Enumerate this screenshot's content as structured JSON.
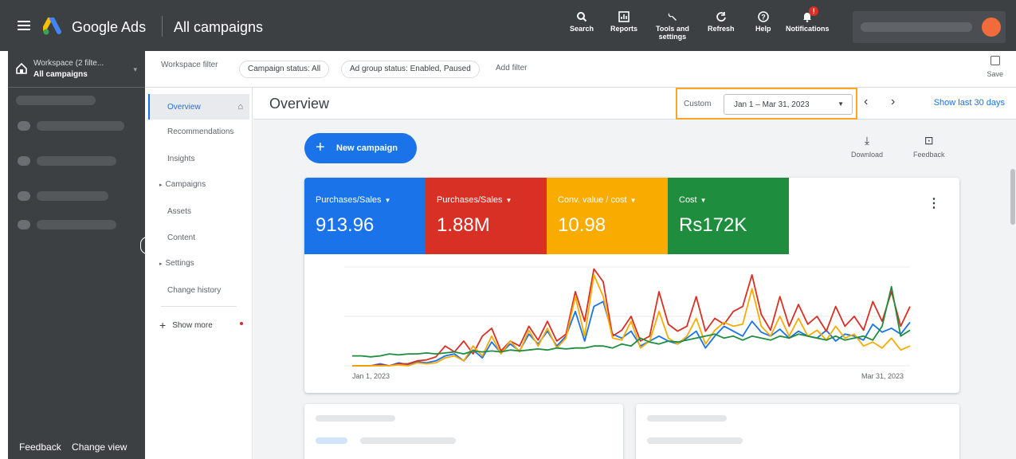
{
  "app": {
    "name": "Google Ads",
    "page": "All campaigns"
  },
  "toolbar": {
    "search": "Search",
    "reports": "Reports",
    "tools_line1": "Tools and",
    "tools_line2": "settings",
    "refresh": "Refresh",
    "help": "Help",
    "notifications": "Notifications",
    "notif_badge": "!"
  },
  "workspace": {
    "line1": "Workspace (2 filte...",
    "line2": "All campaigns"
  },
  "leftnav_footer": {
    "feedback": "Feedback",
    "change_view": "Change view"
  },
  "filters": {
    "workspace_filter": "Workspace filter",
    "campaign_status": "Campaign status: All",
    "ad_group_status": "Ad group status: Enabled, Paused",
    "add_filter": "Add filter",
    "save": "Save"
  },
  "subnav": {
    "overview": "Overview",
    "items": [
      "Recommendations",
      "Insights",
      "Campaigns",
      "Assets",
      "Content",
      "Settings",
      "Change history"
    ],
    "show_more": "Show more"
  },
  "overview": {
    "title": "Overview",
    "custom": "Custom",
    "range": "Jan 1 – Mar 31, 2023",
    "show_last": "Show last 30 days",
    "new_campaign": "New campaign",
    "download": "Download",
    "feedback": "Feedback"
  },
  "metrics": [
    {
      "label": "Purchases/Sales",
      "value": "913.96",
      "color": "#1a73e8"
    },
    {
      "label": "Purchases/Sales",
      "value": "1.88M",
      "color": "#d93025"
    },
    {
      "label": "Conv. value / cost",
      "value": "10.98",
      "color": "#f9ab00"
    },
    {
      "label": "Cost",
      "value": "Rs172K",
      "color": "#1e8e3e"
    }
  ],
  "chart_data": {
    "type": "line",
    "x_start": "Jan 1, 2023",
    "x_end": "Mar 31, 2023",
    "series": [
      {
        "color": "#1a73e8",
        "values": [
          0.0,
          0.0,
          0.0,
          0.02,
          0.0,
          0.03,
          0.01,
          0.04,
          0.03,
          0.05,
          0.1,
          0.12,
          0.05,
          0.16,
          0.08,
          0.24,
          0.13,
          0.22,
          0.15,
          0.32,
          0.22,
          0.35,
          0.2,
          0.3,
          0.55,
          0.25,
          0.6,
          0.65,
          0.32,
          0.28,
          0.35,
          0.2,
          0.25,
          0.3,
          0.25,
          0.22,
          0.28,
          0.35,
          0.18,
          0.3,
          0.4,
          0.35,
          0.3,
          0.45,
          0.34,
          0.3,
          0.37,
          0.28,
          0.35,
          0.3,
          0.28,
          0.36,
          0.25,
          0.32,
          0.3,
          0.26,
          0.42,
          0.34,
          0.38,
          0.32,
          0.44
        ]
      },
      {
        "color": "#d93025",
        "values": [
          0.0,
          0.0,
          0.0,
          0.01,
          0.0,
          0.02,
          0.02,
          0.05,
          0.06,
          0.09,
          0.2,
          0.14,
          0.25,
          0.12,
          0.3,
          0.38,
          0.15,
          0.25,
          0.2,
          0.4,
          0.26,
          0.45,
          0.25,
          0.32,
          0.75,
          0.45,
          0.98,
          0.85,
          0.3,
          0.36,
          0.5,
          0.25,
          0.3,
          0.75,
          0.42,
          0.35,
          0.4,
          0.7,
          0.35,
          0.48,
          0.42,
          0.55,
          0.6,
          0.92,
          0.52,
          0.36,
          0.7,
          0.4,
          0.62,
          0.42,
          0.5,
          0.35,
          0.6,
          0.4,
          0.5,
          0.36,
          0.65,
          0.45,
          0.75,
          0.4,
          0.6
        ]
      },
      {
        "color": "#f9ab00",
        "values": [
          0.0,
          0.0,
          0.0,
          0.0,
          0.0,
          0.01,
          0.0,
          0.03,
          0.02,
          0.03,
          0.08,
          0.1,
          0.05,
          0.2,
          0.1,
          0.3,
          0.12,
          0.25,
          0.14,
          0.36,
          0.2,
          0.38,
          0.18,
          0.28,
          0.7,
          0.3,
          0.92,
          0.7,
          0.28,
          0.26,
          0.45,
          0.18,
          0.25,
          0.55,
          0.28,
          0.22,
          0.3,
          0.48,
          0.22,
          0.36,
          0.44,
          0.4,
          0.42,
          0.78,
          0.4,
          0.3,
          0.5,
          0.3,
          0.48,
          0.3,
          0.36,
          0.26,
          0.4,
          0.28,
          0.32,
          0.2,
          0.24,
          0.18,
          0.28,
          0.16,
          0.2
        ]
      },
      {
        "color": "#1e8e3e",
        "values": [
          0.1,
          0.1,
          0.09,
          0.1,
          0.12,
          0.11,
          0.12,
          0.12,
          0.13,
          0.12,
          0.13,
          0.14,
          0.12,
          0.15,
          0.14,
          0.15,
          0.14,
          0.16,
          0.15,
          0.16,
          0.17,
          0.16,
          0.18,
          0.17,
          0.18,
          0.18,
          0.2,
          0.2,
          0.18,
          0.22,
          0.2,
          0.28,
          0.24,
          0.22,
          0.25,
          0.24,
          0.26,
          0.28,
          0.3,
          0.32,
          0.28,
          0.3,
          0.26,
          0.3,
          0.28,
          0.26,
          0.3,
          0.28,
          0.32,
          0.3,
          0.28,
          0.26,
          0.3,
          0.26,
          0.28,
          0.3,
          0.26,
          0.4,
          0.8,
          0.3,
          0.36
        ]
      }
    ],
    "grid": true
  }
}
